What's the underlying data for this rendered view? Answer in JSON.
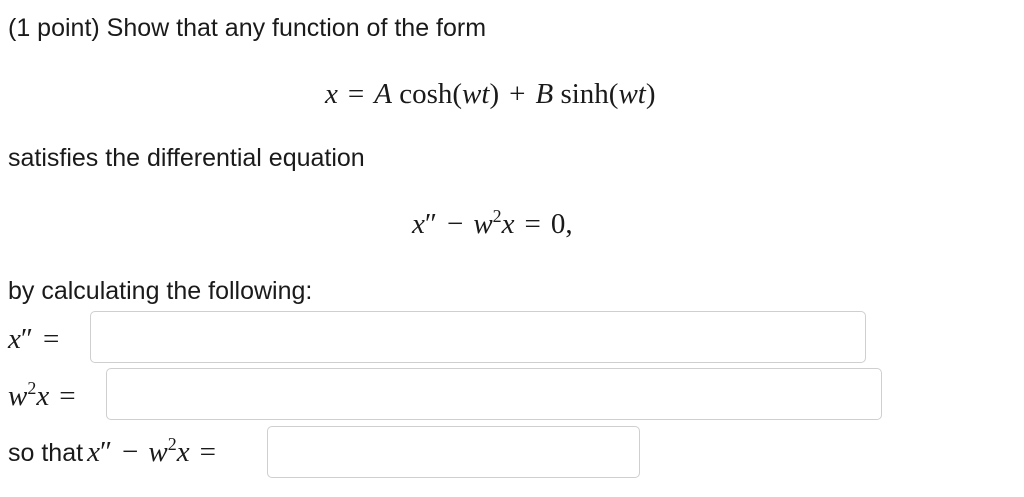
{
  "problem": {
    "intro": "(1 point) Show that any function of the form",
    "satisfies_text": "satisfies the differential equation",
    "by_calculating_text": "by calculating the following:",
    "so_that_text": "so that"
  },
  "equations": {
    "function_form": {
      "lhs": "x",
      "eq": "=",
      "A": "A",
      "cosh": "cosh(",
      "wt1": "wt",
      "close1": ")",
      "plus": "+",
      "B": "B",
      "sinh": "sinh(",
      "wt2": "wt",
      "close2": ")"
    },
    "differential": {
      "x": "x",
      "primes": "″",
      "minus": "−",
      "w": "w",
      "exp": "2",
      "x2": "x",
      "eq": "=",
      "rhs": "0,"
    }
  },
  "answers": {
    "x_double_prime": {
      "var": "x",
      "primes": "″",
      "eq": "=",
      "value": ""
    },
    "w2x": {
      "w": "w",
      "exp": "2",
      "x": "x",
      "eq": "=",
      "value": ""
    },
    "difference": {
      "x": "x",
      "primes": "″",
      "minus": "−",
      "w": "w",
      "exp": "2",
      "x2": "x",
      "eq": "=",
      "value": ""
    }
  }
}
